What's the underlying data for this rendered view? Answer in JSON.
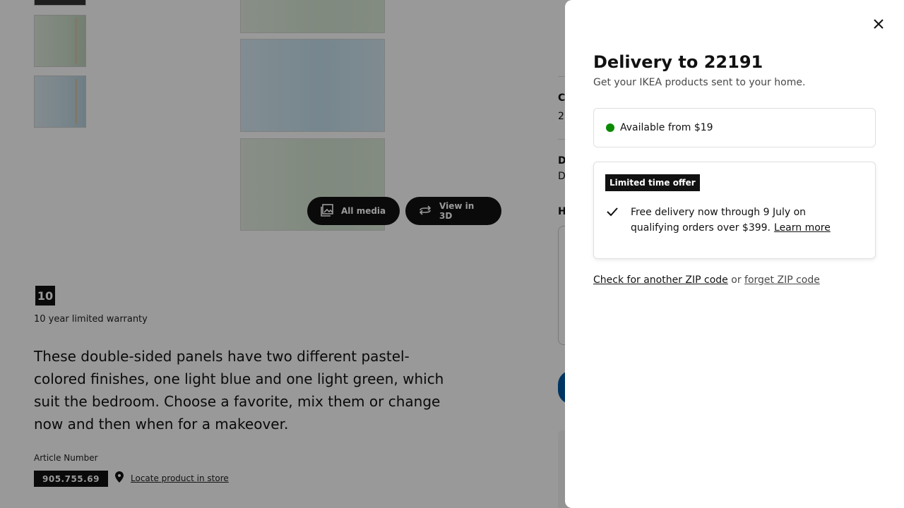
{
  "product": {
    "media_buttons": {
      "all_media": "All media",
      "view_3d": "View in 3D"
    },
    "warranty": {
      "badge": "10",
      "text": "10 year limited warranty"
    },
    "description": "These double-sided panels have two different pastel-colored finishes, one light blue and one light green, which suit the bedroom. Choose a favorite, mix them or change now and then when for a makeover.",
    "article": {
      "label": "Article Number",
      "number": "905.755.69",
      "locate_link": "Locate product in store"
    },
    "right_column": {
      "heading_1": "C",
      "text_1": "2",
      "heading_2": "D",
      "text_2": "D",
      "heading_3": "H"
    }
  },
  "modal": {
    "title": "Delivery to 22191",
    "subtitle": "Get your IKEA products sent to your home.",
    "availability": {
      "text": "Available from $19",
      "status_color": "#0a8a00"
    },
    "offer": {
      "tag": "Limited time offer",
      "text": "Free delivery now through 9 July on qualifying orders over $399.",
      "link": "Learn more"
    },
    "zip": {
      "check_link": "Check for another ZIP code",
      "or": "or",
      "forget_link": "forget ZIP code"
    }
  }
}
